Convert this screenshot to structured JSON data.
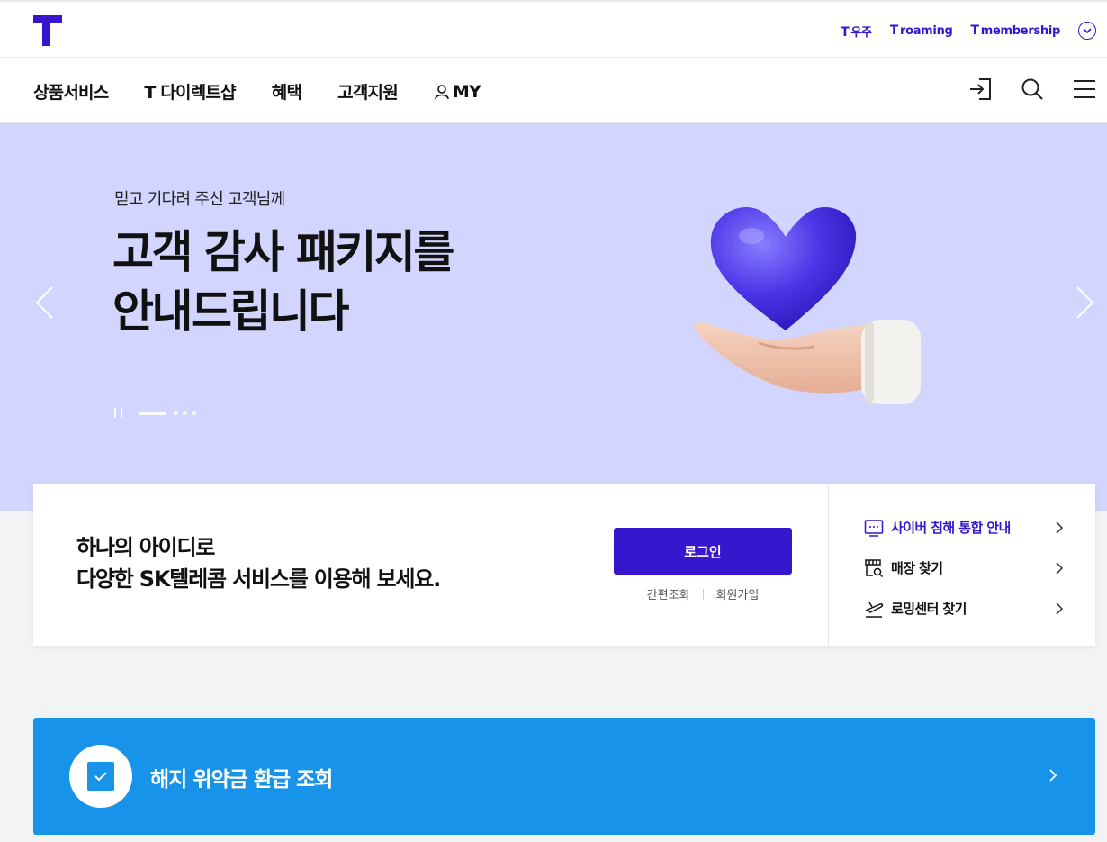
{
  "header": {
    "util_links": [
      {
        "prefix": "T",
        "label": "우주"
      },
      {
        "prefix": "T",
        "label": "roaming"
      },
      {
        "prefix": "T",
        "label": "membership"
      }
    ]
  },
  "gnb": {
    "items": [
      "상품서비스",
      "T 다이렉트샵",
      "혜택",
      "고객지원",
      "MY"
    ]
  },
  "hero": {
    "subtitle": "믿고 기다려 주신 고객님께",
    "title_line1": "고객 감사 패키지를",
    "title_line2": "안내드립니다"
  },
  "login": {
    "message_line1": "하나의 아이디로",
    "message_line2": "다양한 SK텔레콤 서비스를 이용해 보세요.",
    "button_label": "로그인",
    "easy_lookup": "간편조회",
    "signup": "회원가입"
  },
  "quick_links": [
    {
      "label": "사이버 침해 통합 안내",
      "icon": "monitor-chat-icon"
    },
    {
      "label": "매장 찾기",
      "icon": "store-icon"
    },
    {
      "label": "로밍센터 찾기",
      "icon": "airplane-icon"
    }
  ],
  "refund": {
    "label": "해지 위약금 환급 조회"
  },
  "colors": {
    "brand": "#3617ce",
    "hero_bg": "#d2d6fe",
    "refund_bg": "#1893ea"
  }
}
